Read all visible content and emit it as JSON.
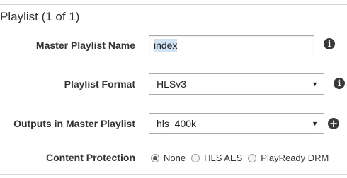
{
  "section": {
    "title": "Playlist (1 of 1)"
  },
  "fields": {
    "master_playlist_name": {
      "label": "Master Playlist Name",
      "value": "index",
      "info_icon": "info-icon"
    },
    "playlist_format": {
      "label": "Playlist Format",
      "value": "HLSv3",
      "info_icon": "info-icon"
    },
    "outputs_in_master_playlist": {
      "label": "Outputs in Master Playlist",
      "value": "hls_400k",
      "add_icon": "plus-icon"
    },
    "content_protection": {
      "label": "Content Protection",
      "options": [
        "None",
        "HLS AES",
        "PlayReady DRM"
      ],
      "selected": "None"
    }
  },
  "colors": {
    "text": "#333333",
    "icon": "#3a3a3a",
    "selection_highlight": "#cfe3f4",
    "border": "#a9a9a9"
  }
}
